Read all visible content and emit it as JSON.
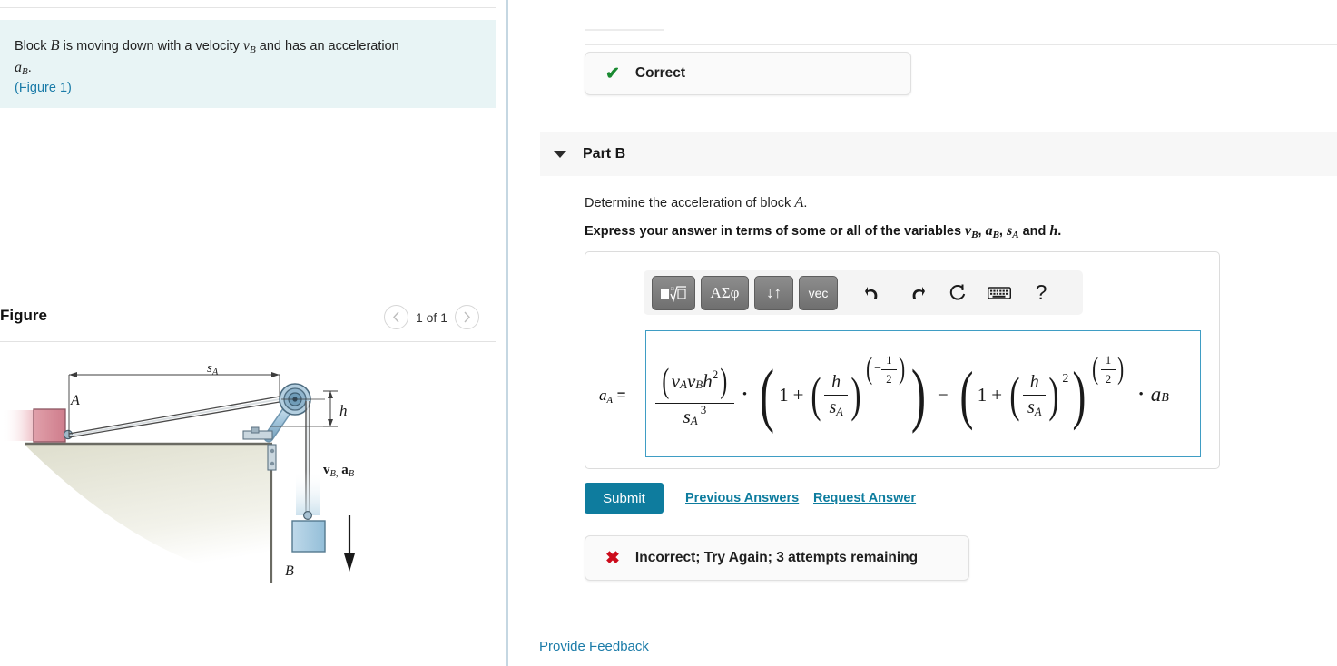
{
  "problem": {
    "text_before": "Block",
    "var_block": "B",
    "text_mid": "is moving down with a velocity",
    "velocity_var": "v",
    "velocity_sub": "B",
    "text_after": "and has an acceleration",
    "accel_var": "a",
    "accel_sub": "B",
    "period": ".",
    "figure_link": "(Figure 1)"
  },
  "figure": {
    "title": "Figure",
    "counter": "1 of 1",
    "prev_icon": "chevron-left-icon",
    "next_icon": "chevron-right-icon",
    "labels": {
      "block_a": "A",
      "block_b": "B",
      "dimension_sa": "s",
      "dimension_sa_sub": "A",
      "dimension_h": "h",
      "velocity_accel": "v",
      "velocity_sub": "B,",
      "accel": "a",
      "accel_sub": "B"
    },
    "colors": {
      "block_a": "#d98b96",
      "block_b": "#a8cbe0",
      "table": "#d9d9c8",
      "pulley": "#8fb4cc"
    }
  },
  "correct_feedback": {
    "icon": "check-icon",
    "label": "Correct",
    "icon_color": "#1a8a32"
  },
  "part_b": {
    "toggle_icon": "triangle-down-icon",
    "label": "Part B",
    "question": "Determine the acceleration of block",
    "question_var": "A",
    "question_end": ".",
    "express_prefix": "Express your answer in terms of some or all of the variables",
    "express_vars": "v_B, a_B, s_A and h.",
    "v1": "v",
    "v1s": "B",
    "v2": "a",
    "v2s": "B",
    "v3": "s",
    "v3s": "A",
    "and_word": "and",
    "v4": "h"
  },
  "toolbar": {
    "buttons": [
      {
        "name": "template-sqrt-button",
        "label": "■ⁿ√□"
      },
      {
        "name": "greek-letters-button",
        "label": "ΑΣφ"
      },
      {
        "name": "arrows-button",
        "label": "↓↑"
      },
      {
        "name": "vector-button",
        "label": "vec"
      }
    ],
    "undo_icon": "undo-arrow-icon",
    "undo_glyph": "↰",
    "redo_icon": "redo-arrow-icon",
    "redo_glyph": "↱",
    "reset_icon": "refresh-icon",
    "reset_glyph": "↻",
    "keyboard_icon": "keyboard-icon",
    "keyboard_glyph": "⌨",
    "help_icon": "help-question-icon",
    "help_glyph": "?"
  },
  "answer": {
    "lhs_var": "a",
    "lhs_sub": "A",
    "equals": "=",
    "numerator": {
      "v1": "v",
      "v1s": "A",
      "v2": "v",
      "v2s": "B",
      "h": "h",
      "hexp": "2"
    },
    "denominator": {
      "s": "s",
      "ssub": "A",
      "exp": "3"
    },
    "dot": "•",
    "term1": {
      "one": "1",
      "plus": "+",
      "h": "h",
      "s": "s",
      "ssub": "A",
      "exp_minus": "−",
      "exp_num": "1",
      "exp_den": "2"
    },
    "minus": "−",
    "term2": {
      "one": "1",
      "plus": "+",
      "h": "h",
      "s": "s",
      "ssub": "A",
      "inner_exp": "2",
      "exp_num": "1",
      "exp_den": "2"
    },
    "dot2": "•",
    "rhs_var": "a",
    "rhs_sub": "B"
  },
  "actions": {
    "submit_label": "Submit",
    "previous_answers_label": "Previous Answers",
    "request_answer_label": "Request Answer",
    "submit_color": "#0e7c9e"
  },
  "incorrect_feedback": {
    "icon": "x-icon",
    "label": "Incorrect; Try Again; 3 attempts remaining",
    "icon_color": "#cc0c1c"
  },
  "footer": {
    "provide_feedback_label": "Provide Feedback"
  }
}
